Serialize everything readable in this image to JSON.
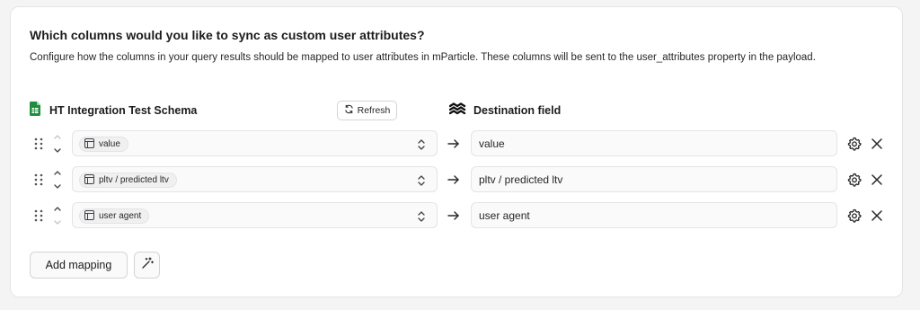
{
  "section": {
    "title": "Which columns would you like to sync as custom user attributes?",
    "description": "Configure how the columns in your query results should be mapped to user attributes in mParticle. These columns will be sent to the user_attributes property in the payload."
  },
  "source_header": {
    "icon": "google-sheets-icon",
    "label": "HT Integration Test Schema",
    "refresh_label": "Refresh"
  },
  "destination_header": {
    "icon": "mparticle-logo-icon",
    "label": "Destination field"
  },
  "mappings": [
    {
      "source": "value",
      "destination": "value"
    },
    {
      "source": "pltv / predicted ltv",
      "destination": "pltv / predicted ltv"
    },
    {
      "source": "user agent",
      "destination": "user agent"
    }
  ],
  "actions": {
    "add_mapping_label": "Add mapping",
    "magic_icon": "magic-wand-icon"
  },
  "colors": {
    "sheets_green": "#1e8e3e",
    "border": "#e4e4e7",
    "text": "#1c1c1e"
  }
}
